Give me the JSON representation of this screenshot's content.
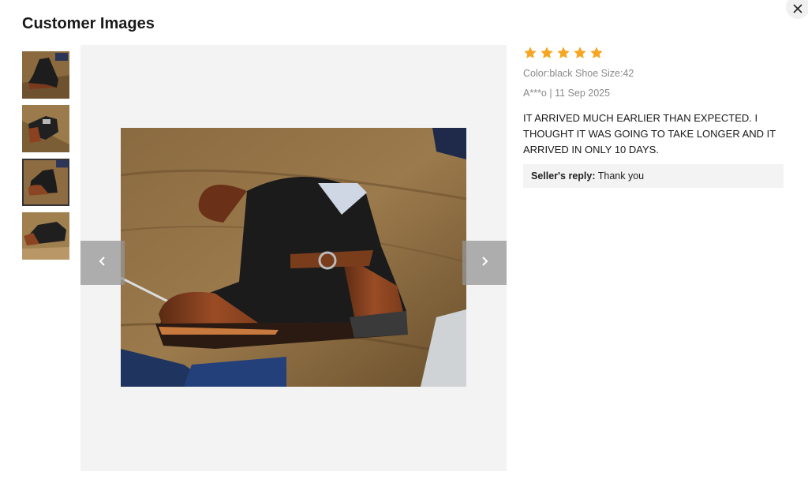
{
  "title": "Customer Images",
  "close_icon": "close-icon",
  "thumbnails": [
    {
      "name": "thumbnail-1",
      "selected": false
    },
    {
      "name": "thumbnail-2",
      "selected": false
    },
    {
      "name": "thumbnail-3",
      "selected": true
    },
    {
      "name": "thumbnail-4",
      "selected": false
    }
  ],
  "viewer": {
    "prev_icon": "chevron-left-icon",
    "next_icon": "chevron-right-icon"
  },
  "review": {
    "rating": 5,
    "star_color": "#f5a623",
    "variant": "Color:black Shoe Size:42",
    "author_date": "A***o | 11 Sep 2025",
    "text": "IT ARRIVED MUCH EARLIER THAN EXPECTED. I THOUGHT IT WAS GOING TO TAKE LONGER AND IT ARRIVED IN ONLY 10 DAYS.",
    "reply_label": "Seller's reply:",
    "reply_text": "Thank you"
  }
}
